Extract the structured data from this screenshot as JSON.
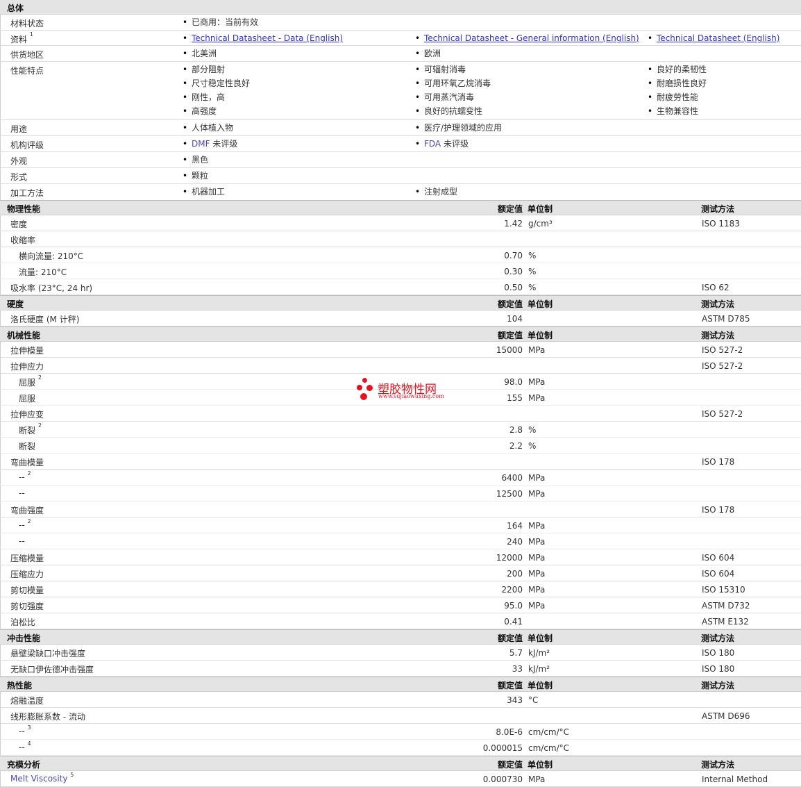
{
  "general": {
    "title": "总体",
    "status_label": "材料状态",
    "status_value": "已商用：当前有效",
    "docs_label": "资料",
    "docs_sup": "1",
    "docs": [
      "Technical Datasheet - Data (English)",
      "Technical Datasheet - General information (English)",
      "Technical Datasheet (English)"
    ],
    "region_label": "供货地区",
    "regions": [
      "北美洲",
      "欧洲"
    ],
    "features_label": "性能特点",
    "features_col1": [
      "部分阻射",
      "尺寸稳定性良好",
      "刚性，高",
      "高强度"
    ],
    "features_col2": [
      "可辐射消毒",
      "可用环氧乙烷消毒",
      "可用蒸汽消毒",
      "良好的抗蠕变性"
    ],
    "features_col3": [
      "良好的柔韧性",
      "耐磨损性良好",
      "耐疲劳性能",
      "生物兼容性"
    ],
    "uses_label": "用途",
    "uses": [
      "人体植入物",
      "医疗/护理领域的应用"
    ],
    "rating_label": "机构评级",
    "rating1_tag": "DMF",
    "rating1_text": "未评级",
    "rating2_tag": "FDA",
    "rating2_text": "未评级",
    "appearance_label": "外观",
    "appearance": "黑色",
    "form_label": "形式",
    "form": "颗粒",
    "processing_label": "加工方法",
    "processing": [
      "机器加工",
      "注射成型"
    ]
  },
  "headers": {
    "value": "额定值",
    "unit": "单位制",
    "method": "测试方法"
  },
  "physical": {
    "title": "物理性能",
    "rows": [
      {
        "label": "密度",
        "value": "1.42",
        "unit": "g/cm³",
        "method": "ISO 1183"
      },
      {
        "label": "收缩率",
        "value": "",
        "unit": "",
        "method": ""
      },
      {
        "label": "横向流量: 210°C",
        "value": "0.70",
        "unit": "%",
        "method": ""
      },
      {
        "label": "流量: 210°C",
        "value": "0.30",
        "unit": "%",
        "method": ""
      },
      {
        "label": "吸水率",
        "note": "(23°C, 24 hr)",
        "value": "0.50",
        "unit": "%",
        "method": "ISO 62"
      }
    ]
  },
  "hardness": {
    "title": "硬度",
    "rows": [
      {
        "label": "洛氏硬度",
        "note": "(M 计秤)",
        "value": "104",
        "unit": "",
        "method": "ASTM D785"
      }
    ]
  },
  "mechanical": {
    "title": "机械性能",
    "rows": [
      {
        "label": "拉伸模量",
        "value": "15000",
        "unit": "MPa",
        "method": "ISO 527-2"
      },
      {
        "label": "拉伸应力",
        "value": "",
        "unit": "",
        "method": "ISO 527-2"
      },
      {
        "label": "屈服",
        "sup": "2",
        "value": "98.0",
        "unit": "MPa",
        "method": ""
      },
      {
        "label": "屈服",
        "value": "155",
        "unit": "MPa",
        "method": ""
      },
      {
        "label": "拉伸应变",
        "value": "",
        "unit": "",
        "method": "ISO 527-2"
      },
      {
        "label": "断裂",
        "sup": "2",
        "value": "2.8",
        "unit": "%",
        "method": ""
      },
      {
        "label": "断裂",
        "value": "2.2",
        "unit": "%",
        "method": ""
      },
      {
        "label": "弯曲模量",
        "value": "",
        "unit": "",
        "method": "ISO 178"
      },
      {
        "label": "--",
        "sup": "2",
        "value": "6400",
        "unit": "MPa",
        "method": ""
      },
      {
        "label": "--",
        "value": "12500",
        "unit": "MPa",
        "method": ""
      },
      {
        "label": "弯曲强度",
        "value": "",
        "unit": "",
        "method": "ISO 178"
      },
      {
        "label": "--",
        "sup": "2",
        "value": "164",
        "unit": "MPa",
        "method": ""
      },
      {
        "label": "--",
        "value": "240",
        "unit": "MPa",
        "method": ""
      },
      {
        "label": "压缩模量",
        "value": "12000",
        "unit": "MPa",
        "method": "ISO 604"
      },
      {
        "label": "压缩应力",
        "value": "200",
        "unit": "MPa",
        "method": "ISO 604"
      },
      {
        "label": "剪切模量",
        "value": "2200",
        "unit": "MPa",
        "method": "ISO 15310"
      },
      {
        "label": "剪切强度",
        "value": "95.0",
        "unit": "MPa",
        "method": "ASTM D732"
      },
      {
        "label": "泊松比",
        "value": "0.41",
        "unit": "",
        "method": "ASTM E132"
      }
    ]
  },
  "impact": {
    "title": "冲击性能",
    "rows": [
      {
        "label": "悬壁梁缺口冲击强度",
        "value": "5.7",
        "unit": "kJ/m²",
        "method": "ISO 180"
      },
      {
        "label": "无缺口伊佐德冲击强度",
        "value": "33",
        "unit": "kJ/m²",
        "method": "ISO 180"
      }
    ]
  },
  "thermal": {
    "title": "热性能",
    "rows": [
      {
        "label": "熔融温度",
        "value": "343",
        "unit": "°C",
        "method": ""
      },
      {
        "label": "线形膨胀系数 - 流动",
        "value": "",
        "unit": "",
        "method": "ASTM D696"
      },
      {
        "label": "--",
        "sup": "3",
        "value": "8.0E-6",
        "unit": "cm/cm/°C",
        "method": ""
      },
      {
        "label": "--",
        "sup": "4",
        "value": "0.000015",
        "unit": "cm/cm/°C",
        "method": ""
      }
    ]
  },
  "mold": {
    "title": "充模分析",
    "rows": [
      {
        "label": "Melt Viscosity",
        "sup": "5",
        "value": "0.000730",
        "unit": "MPa",
        "method": "Internal Method"
      }
    ]
  },
  "watermark": {
    "name": "塑胶物性网",
    "url": "www.sujiaowuxing.com",
    "color": "#e8121e"
  },
  "colors": {
    "section_bg": "#e4e4e4",
    "link": "#3333cc",
    "tag": "#4848b8"
  }
}
